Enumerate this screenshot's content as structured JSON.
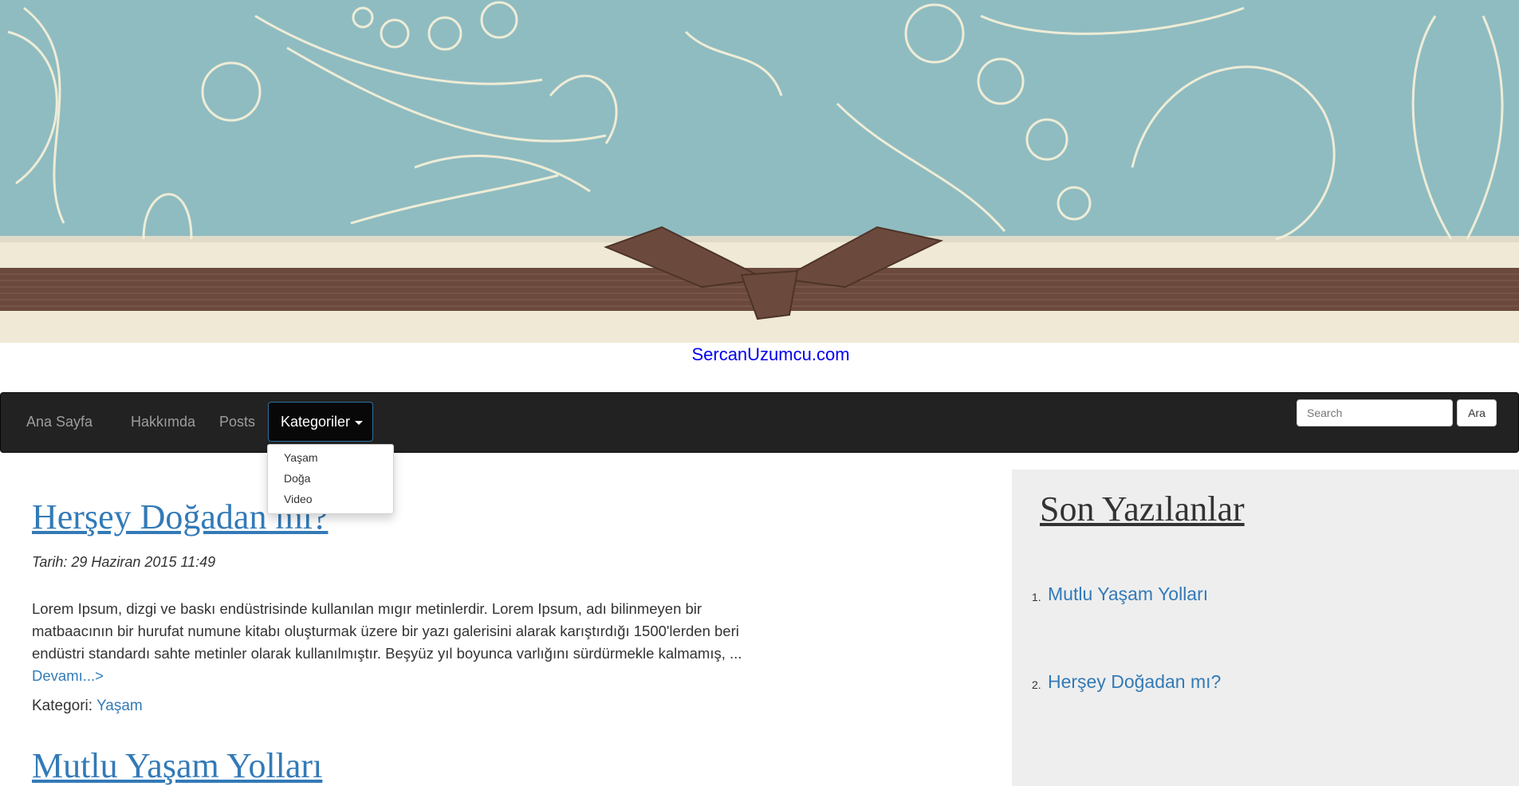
{
  "site": {
    "title": "SercanUzumcu.com"
  },
  "navbar": {
    "items": [
      {
        "label": "Ana Sayfa"
      },
      {
        "label": "Hakkımda"
      },
      {
        "label": "Posts"
      }
    ],
    "dropdown": {
      "label": "Kategoriler",
      "items": [
        {
          "label": "Yaşam"
        },
        {
          "label": "Doğa"
        },
        {
          "label": "Video"
        }
      ]
    },
    "search": {
      "placeholder": "Search",
      "button_label": "Ara"
    }
  },
  "posts": [
    {
      "title": "Herşey Doğadan mı?",
      "date": "Tarih: 29 Haziran 2015 11:49",
      "excerpt": "Lorem Ipsum, dizgi ve baskı endüstrisinde kullanılan mıgır metinlerdir. Lorem Ipsum, adı bilinmeyen bir matbaacının bir hurufat numune kitabı oluşturmak üzere bir yazı galerisini alarak karıştırdığı 1500'lerden beri endüstri standardı sahte metinler olarak kullanılmıştır. Beşyüz yıl boyunca varlığını sürdürmekle kalmamış, ...",
      "read_more": "Devamı...>",
      "category_label": "Kategori:",
      "category": "Yaşam"
    },
    {
      "title": "Mutlu Yaşam Yolları"
    }
  ],
  "sidebar": {
    "heading": "Son Yazılanlar",
    "items": [
      {
        "num": "1.",
        "label": "Mutlu Yaşam Yolları"
      },
      {
        "num": "2.",
        "label": "Herşey Doğadan mı?"
      }
    ]
  },
  "colors": {
    "banner_teal": "#8fbcc1",
    "banner_cream": "#efe9d6",
    "ribbon_brown": "#6b4a3d",
    "navbar_bg": "#222222",
    "link_blue": "#337ab7",
    "sidebar_bg": "#eeeeee"
  }
}
